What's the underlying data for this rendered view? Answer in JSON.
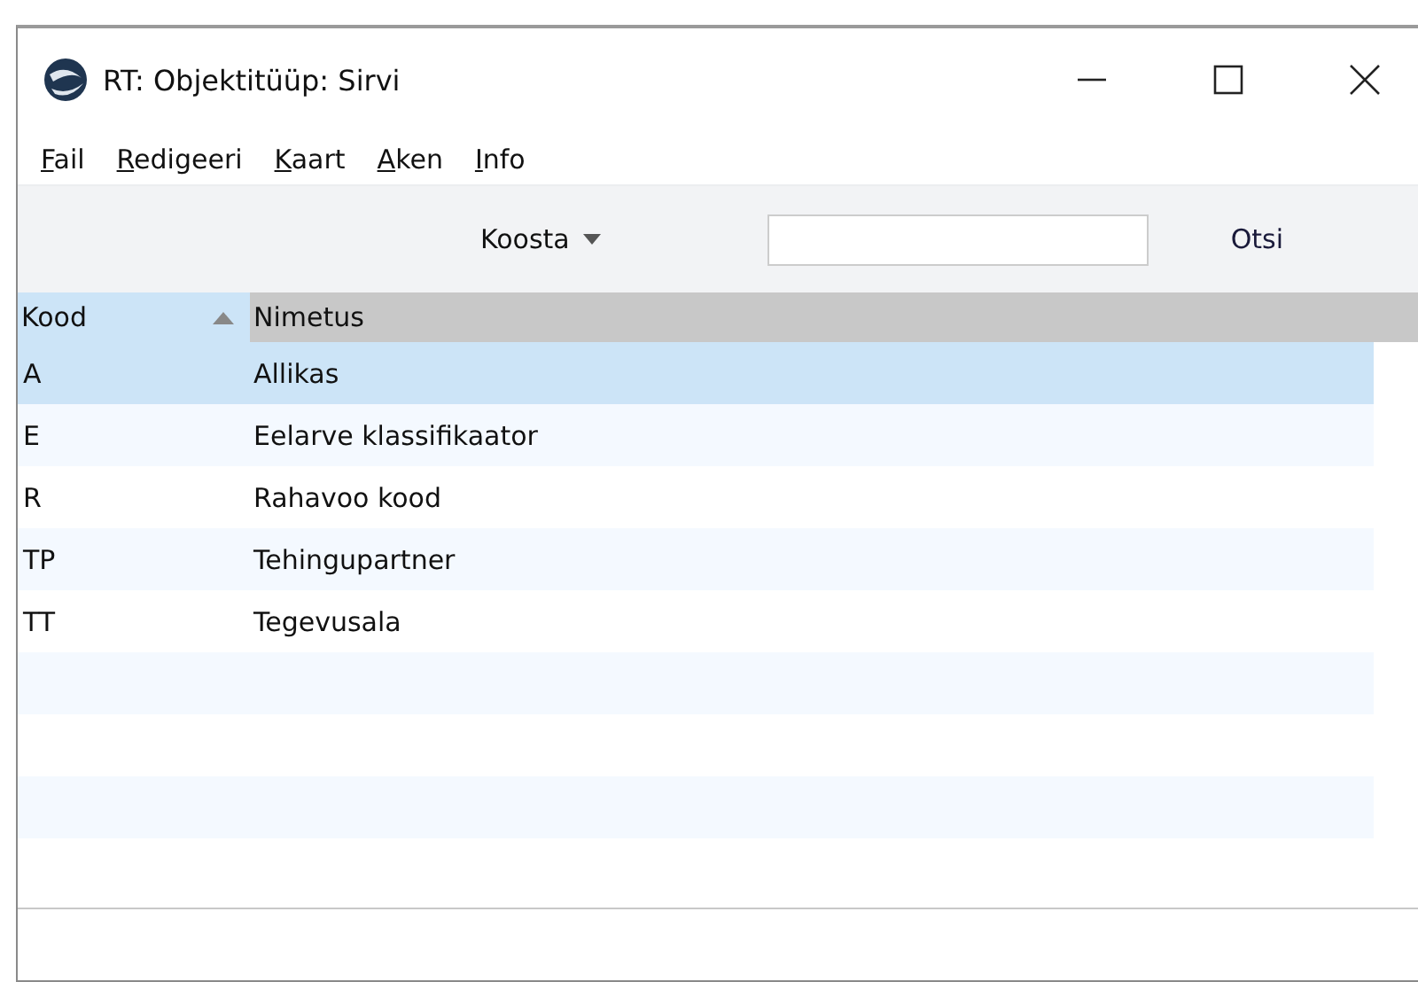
{
  "window": {
    "title": "RT: Objektitüüp: Sirvi"
  },
  "menu": [
    "Fail",
    "Redigeeri",
    "Kaart",
    "Aken",
    "Info"
  ],
  "toolbar": {
    "create_button": "Koosta",
    "search_button": "Otsi"
  },
  "table": {
    "columns": [
      {
        "label": "Kood",
        "sorted": true
      },
      {
        "label": "Nimetus",
        "sorted": false
      }
    ],
    "rows": [
      {
        "code": "A",
        "name": "Allikas",
        "selected": true
      },
      {
        "code": "E",
        "name": "Eelarve klassifikaator",
        "selected": false
      },
      {
        "code": "R",
        "name": "Rahavoo kood",
        "selected": false
      },
      {
        "code": "TP",
        "name": "Tehingupartner",
        "selected": false
      },
      {
        "code": "TT",
        "name": "Tegevusala",
        "selected": false
      }
    ]
  }
}
